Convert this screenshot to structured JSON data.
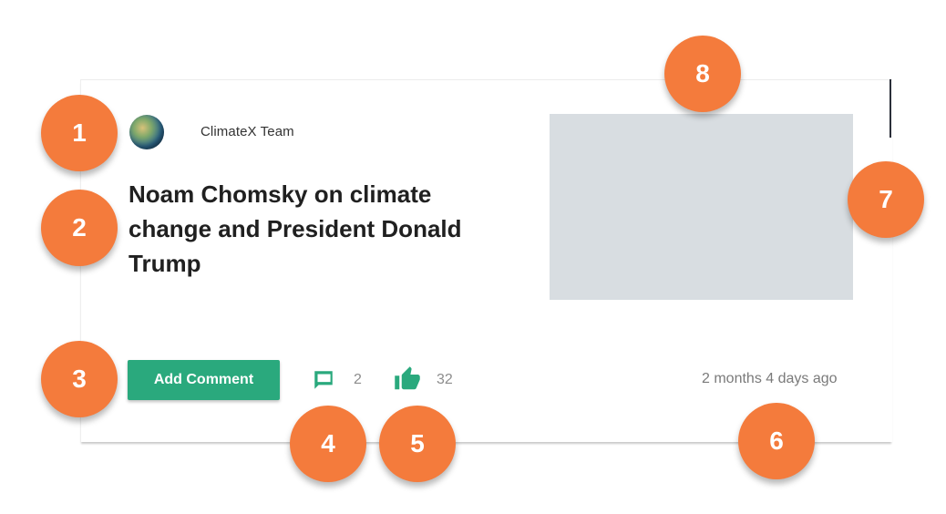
{
  "post": {
    "author": "ClimateX Team",
    "title": "Noam Chomsky on climate change and President Donald Trump",
    "add_comment_label": "Add Comment",
    "comment_count": "2",
    "like_count": "32",
    "timestamp": "2 months 4 days ago"
  },
  "icons": {
    "avatar": "earth-avatar",
    "comment": "comment-icon",
    "like": "thumbs-up-icon"
  },
  "colors": {
    "accent": "#2aa97d",
    "badge": "#f47b3c",
    "thumbnail_placeholder": "#d8dde1"
  },
  "callouts": [
    "1",
    "2",
    "3",
    "4",
    "5",
    "6",
    "7",
    "8"
  ]
}
